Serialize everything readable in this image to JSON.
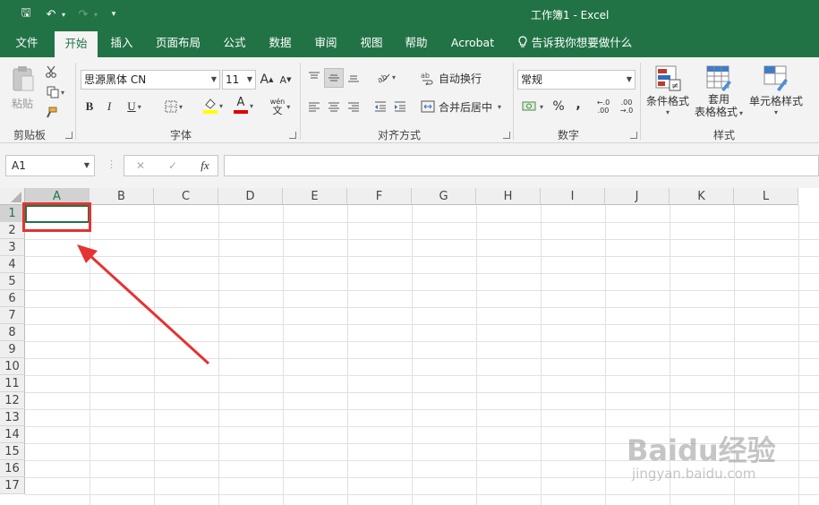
{
  "window": {
    "title": "工作簿1  -  Excel"
  },
  "qat": {
    "save": "🖫",
    "undo": "↶",
    "undo_dd": "▾",
    "redo": "↷",
    "redo_dd": "▾",
    "customize": "▾"
  },
  "tabs": [
    "文件",
    "开始",
    "插入",
    "页面布局",
    "公式",
    "数据",
    "审阅",
    "视图",
    "帮助",
    "Acrobat"
  ],
  "active_tab": "开始",
  "tell_me": "告诉我你想要做什么",
  "ribbon": {
    "clipboard": {
      "label": "剪贴板",
      "paste": "粘贴"
    },
    "font": {
      "label": "字体",
      "name": "思源黑体 CN",
      "size": "11",
      "grow": "A",
      "shrink": "A",
      "bold": "B",
      "italic": "I",
      "underline": "U",
      "font_color_glyph": "A",
      "phonetic_top": "wén",
      "phonetic_bottom": "文"
    },
    "alignment": {
      "label": "对齐方式",
      "wrap": "自动换行",
      "merge": "合并后居中"
    },
    "number": {
      "label": "数字",
      "format": "常规",
      "percent": "%",
      "comma": ",",
      "inc_decimal": "←.0\n.00",
      "dec_decimal": ".00\n→.0"
    },
    "styles": {
      "label": "样式",
      "conditional": "条件格式",
      "table_1": "套用",
      "table_2": "表格格式",
      "cell": "单元格样式"
    }
  },
  "formula_bar": {
    "name_box": "A1",
    "cancel": "✕",
    "enter": "✓",
    "fx": "fx",
    "value": ""
  },
  "columns": [
    "A",
    "B",
    "C",
    "D",
    "E",
    "F",
    "G",
    "H",
    "I",
    "J",
    "K",
    "L"
  ],
  "rows": [
    "1",
    "2",
    "3",
    "4",
    "5",
    "6",
    "7",
    "8",
    "9",
    "10",
    "11",
    "12",
    "13",
    "14",
    "15",
    "16",
    "17"
  ],
  "selected_cell": "A1",
  "colors": {
    "accent": "#217346",
    "highlight": "#e53333"
  },
  "watermark": {
    "logo": "Baidu经验",
    "url": "jingyan.baidu.com"
  }
}
